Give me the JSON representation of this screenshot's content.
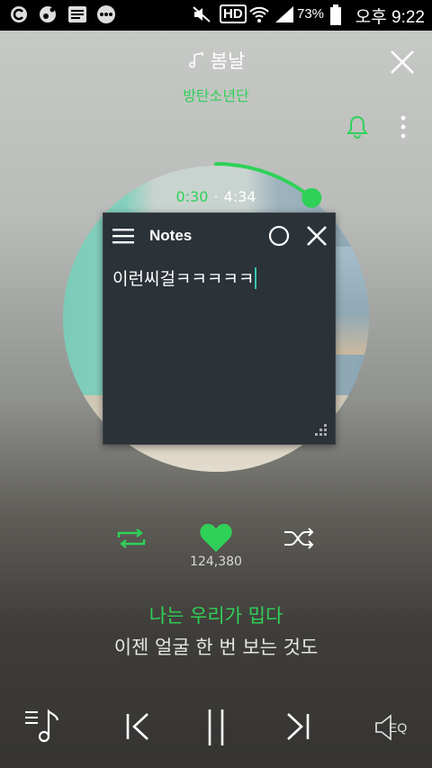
{
  "status_bar": {
    "hd_label": "HD",
    "battery_percent": "73%",
    "time": "오후 9:22"
  },
  "player": {
    "song_title": "봄날",
    "artist": "방탄소년단",
    "time_current": "0:30",
    "time_separator": "·",
    "time_total": "4:34",
    "progress_fraction": 0.109,
    "like_count": "124,380",
    "lyric_current": "나는 우리가 밉다",
    "lyric_next": "이젠 얼굴 한 번 보는 것도",
    "eq_label": "EQ"
  },
  "notes_window": {
    "title": "Notes",
    "content": "이런씨걸ㅋㅋㅋㅋㅋ"
  },
  "colors": {
    "accent": "#2fd158",
    "notes_bg": "#2b3238",
    "caret": "#35c6b0"
  },
  "icons": [
    "music-note-icon",
    "close-icon",
    "bell-icon",
    "more-vertical-icon",
    "repeat-icon",
    "heart-icon",
    "shuffle-icon",
    "playlist-icon",
    "previous-icon",
    "pause-icon",
    "next-icon",
    "equalizer-icon",
    "hamburger-menu-icon",
    "minimize-circle-icon",
    "resize-grip-icon"
  ]
}
